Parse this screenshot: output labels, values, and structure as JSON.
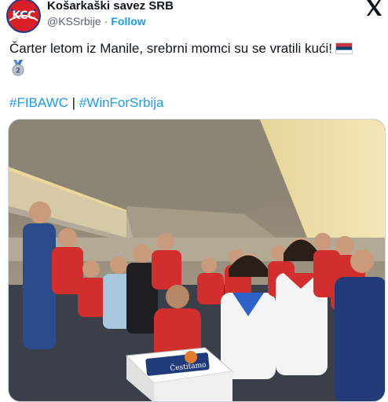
{
  "account": {
    "name": "Košarkaški savez SRB",
    "handle": "@KSSrbije",
    "separator": "·",
    "follow_label": "Follow",
    "avatar_text": "KCC"
  },
  "post": {
    "text": "Čarter letom iz Manile, srebrni momci su se vratili kući!",
    "emojis": [
      "serbia-flag",
      "second-place-medal"
    ],
    "hashtag1": "#FIBAWC",
    "hashtag_separator": " | ",
    "hashtag2": "#WinForSrbija"
  },
  "media": {
    "alt": "photo",
    "cake_text": "Čestitamo"
  },
  "colors": {
    "accent": "#1d9bf0",
    "brand_red": "#d91f26",
    "brand_blue": "#1d3c8c",
    "text": "#0f1419",
    "secondary_text": "#536471"
  }
}
